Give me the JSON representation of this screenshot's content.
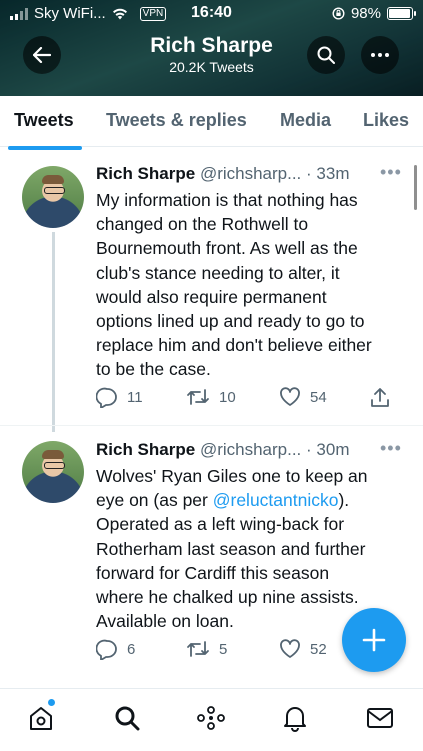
{
  "status_bar": {
    "carrier": "Sky WiFi...",
    "vpn": "VPN",
    "time": "16:40",
    "battery": "98%"
  },
  "header": {
    "name": "Rich Sharpe",
    "tweet_count": "20.2K Tweets"
  },
  "tabs": [
    {
      "label": "Tweets",
      "active": true
    },
    {
      "label": "Tweets & replies",
      "active": false
    },
    {
      "label": "Media",
      "active": false
    },
    {
      "label": "Likes",
      "active": false
    }
  ],
  "tweets": [
    {
      "name": "Rich Sharpe",
      "handle": "@richsharp...",
      "time": "· 33m",
      "text_lines": [
        "My information is that nothing has",
        "changed on the Rothwell to",
        "Bournemouth front. As well as the",
        "club's stance needing to alter, it",
        "would also require permanent",
        "options lined up and ready to go to",
        "replace him and don't believe either",
        "to be the case."
      ],
      "replies": "11",
      "retweets": "10",
      "likes": "54"
    },
    {
      "name": "Rich Sharpe",
      "handle": "@richsharp...",
      "time": "· 30m",
      "line1": "Wolves' Ryan Giles one to keep an",
      "line2_pre": "eye on (as per ",
      "mention": "@reluctantnicko",
      "line2_post": ").",
      "text_lines_rest": [
        "Operated as a left wing-back for",
        "Rotherham last season and further",
        "forward for Cardiff this season",
        "where he chalked up nine assists.",
        "Available on loan."
      ],
      "replies": "6",
      "retweets": "5",
      "likes": "52"
    }
  ],
  "colors": {
    "accent": "#1d9bf0",
    "text": "#0f1419",
    "secondary": "#536471"
  }
}
